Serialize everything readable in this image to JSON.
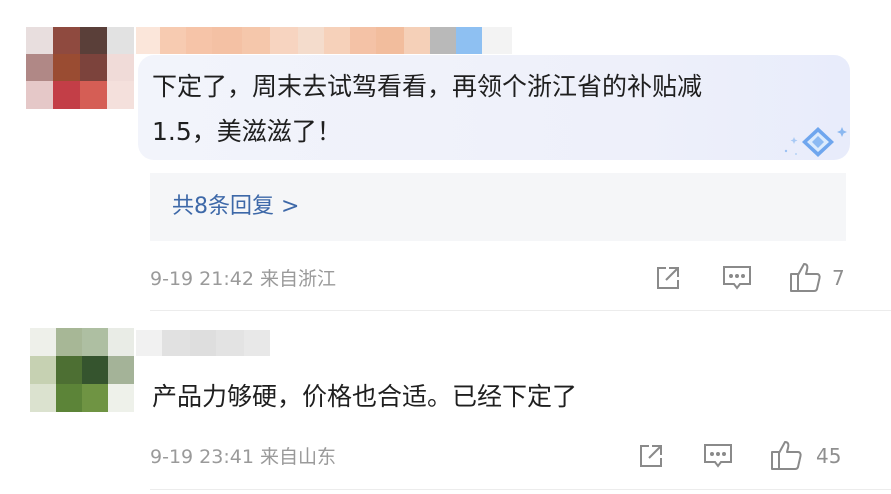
{
  "comments": [
    {
      "text_line1": "下定了，周末去试驾看看，再领个浙江省的补贴减",
      "text_line2": "1.5，美滋滋了！",
      "replies_label": "共8条回复 >",
      "meta": "9-19 21:42 来自浙江",
      "like_count": "7"
    },
    {
      "text_line1": "产品力够硬，价格也合适。已经下定了",
      "meta": "9-19 23:41 来自山东",
      "like_count": "45"
    }
  ],
  "icons": {
    "share": "share-icon",
    "comment": "comment-icon",
    "like": "thumbs-up-icon",
    "badge": "diamond-badge-icon"
  },
  "colors": {
    "link": "#3d68a8",
    "meta": "#9a9a9a",
    "text": "#1f1f1f",
    "badge": "#7fb0f2"
  }
}
